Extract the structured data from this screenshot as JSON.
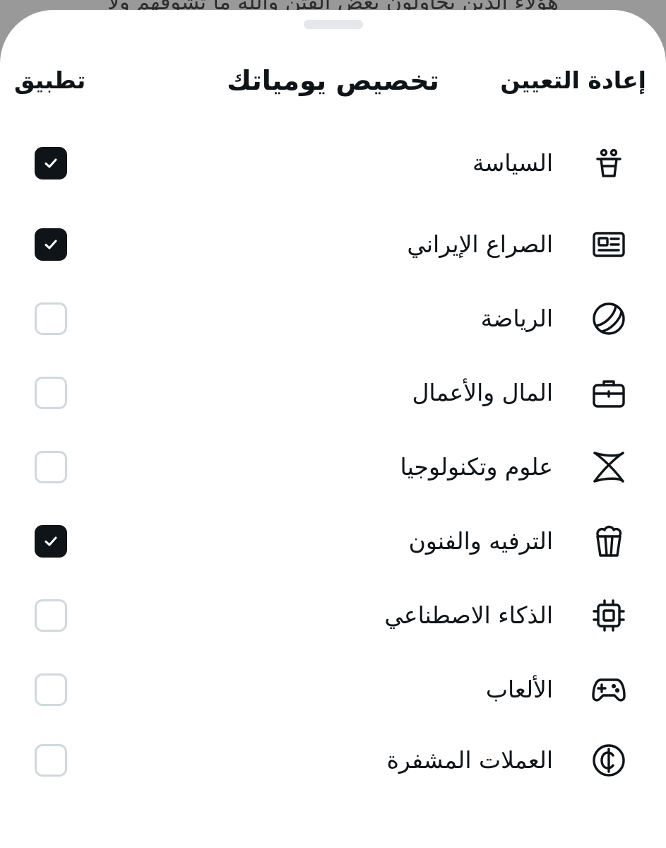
{
  "background_text": "هؤلاء الذين يحاولون بعض الفتن والله ما تشوفهم ولا",
  "header": {
    "apply_label": "تطبيق",
    "title": "تخصيص يومياتك",
    "reset_label": "إعادة التعيين"
  },
  "colors": {
    "text": "#0f1419",
    "checked": "#0f1419",
    "unchecked_border": "#cfd9de",
    "handle": "#e5e7eb",
    "overlay": "#999999"
  },
  "topics": [
    {
      "label": "السياسة",
      "icon": "podium-icon",
      "checked": true
    },
    {
      "label": "الصراع الإيراني",
      "icon": "newspaper-icon",
      "checked": true
    },
    {
      "label": "الرياضة",
      "icon": "tennis-ball-icon",
      "checked": false
    },
    {
      "label": "المال والأعمال",
      "icon": "briefcase-icon",
      "checked": false
    },
    {
      "label": "علوم وتكنولوجيا",
      "icon": "atom-icon",
      "checked": false
    },
    {
      "label": "الترفيه والفنون",
      "icon": "popcorn-icon",
      "checked": true
    },
    {
      "label": "الذكاء الاصطناعي",
      "icon": "chip-icon",
      "checked": false
    },
    {
      "label": "الألعاب",
      "icon": "gamepad-icon",
      "checked": false
    },
    {
      "label": "العملات المشفرة",
      "icon": "crypto-coin-icon",
      "checked": false
    }
  ]
}
